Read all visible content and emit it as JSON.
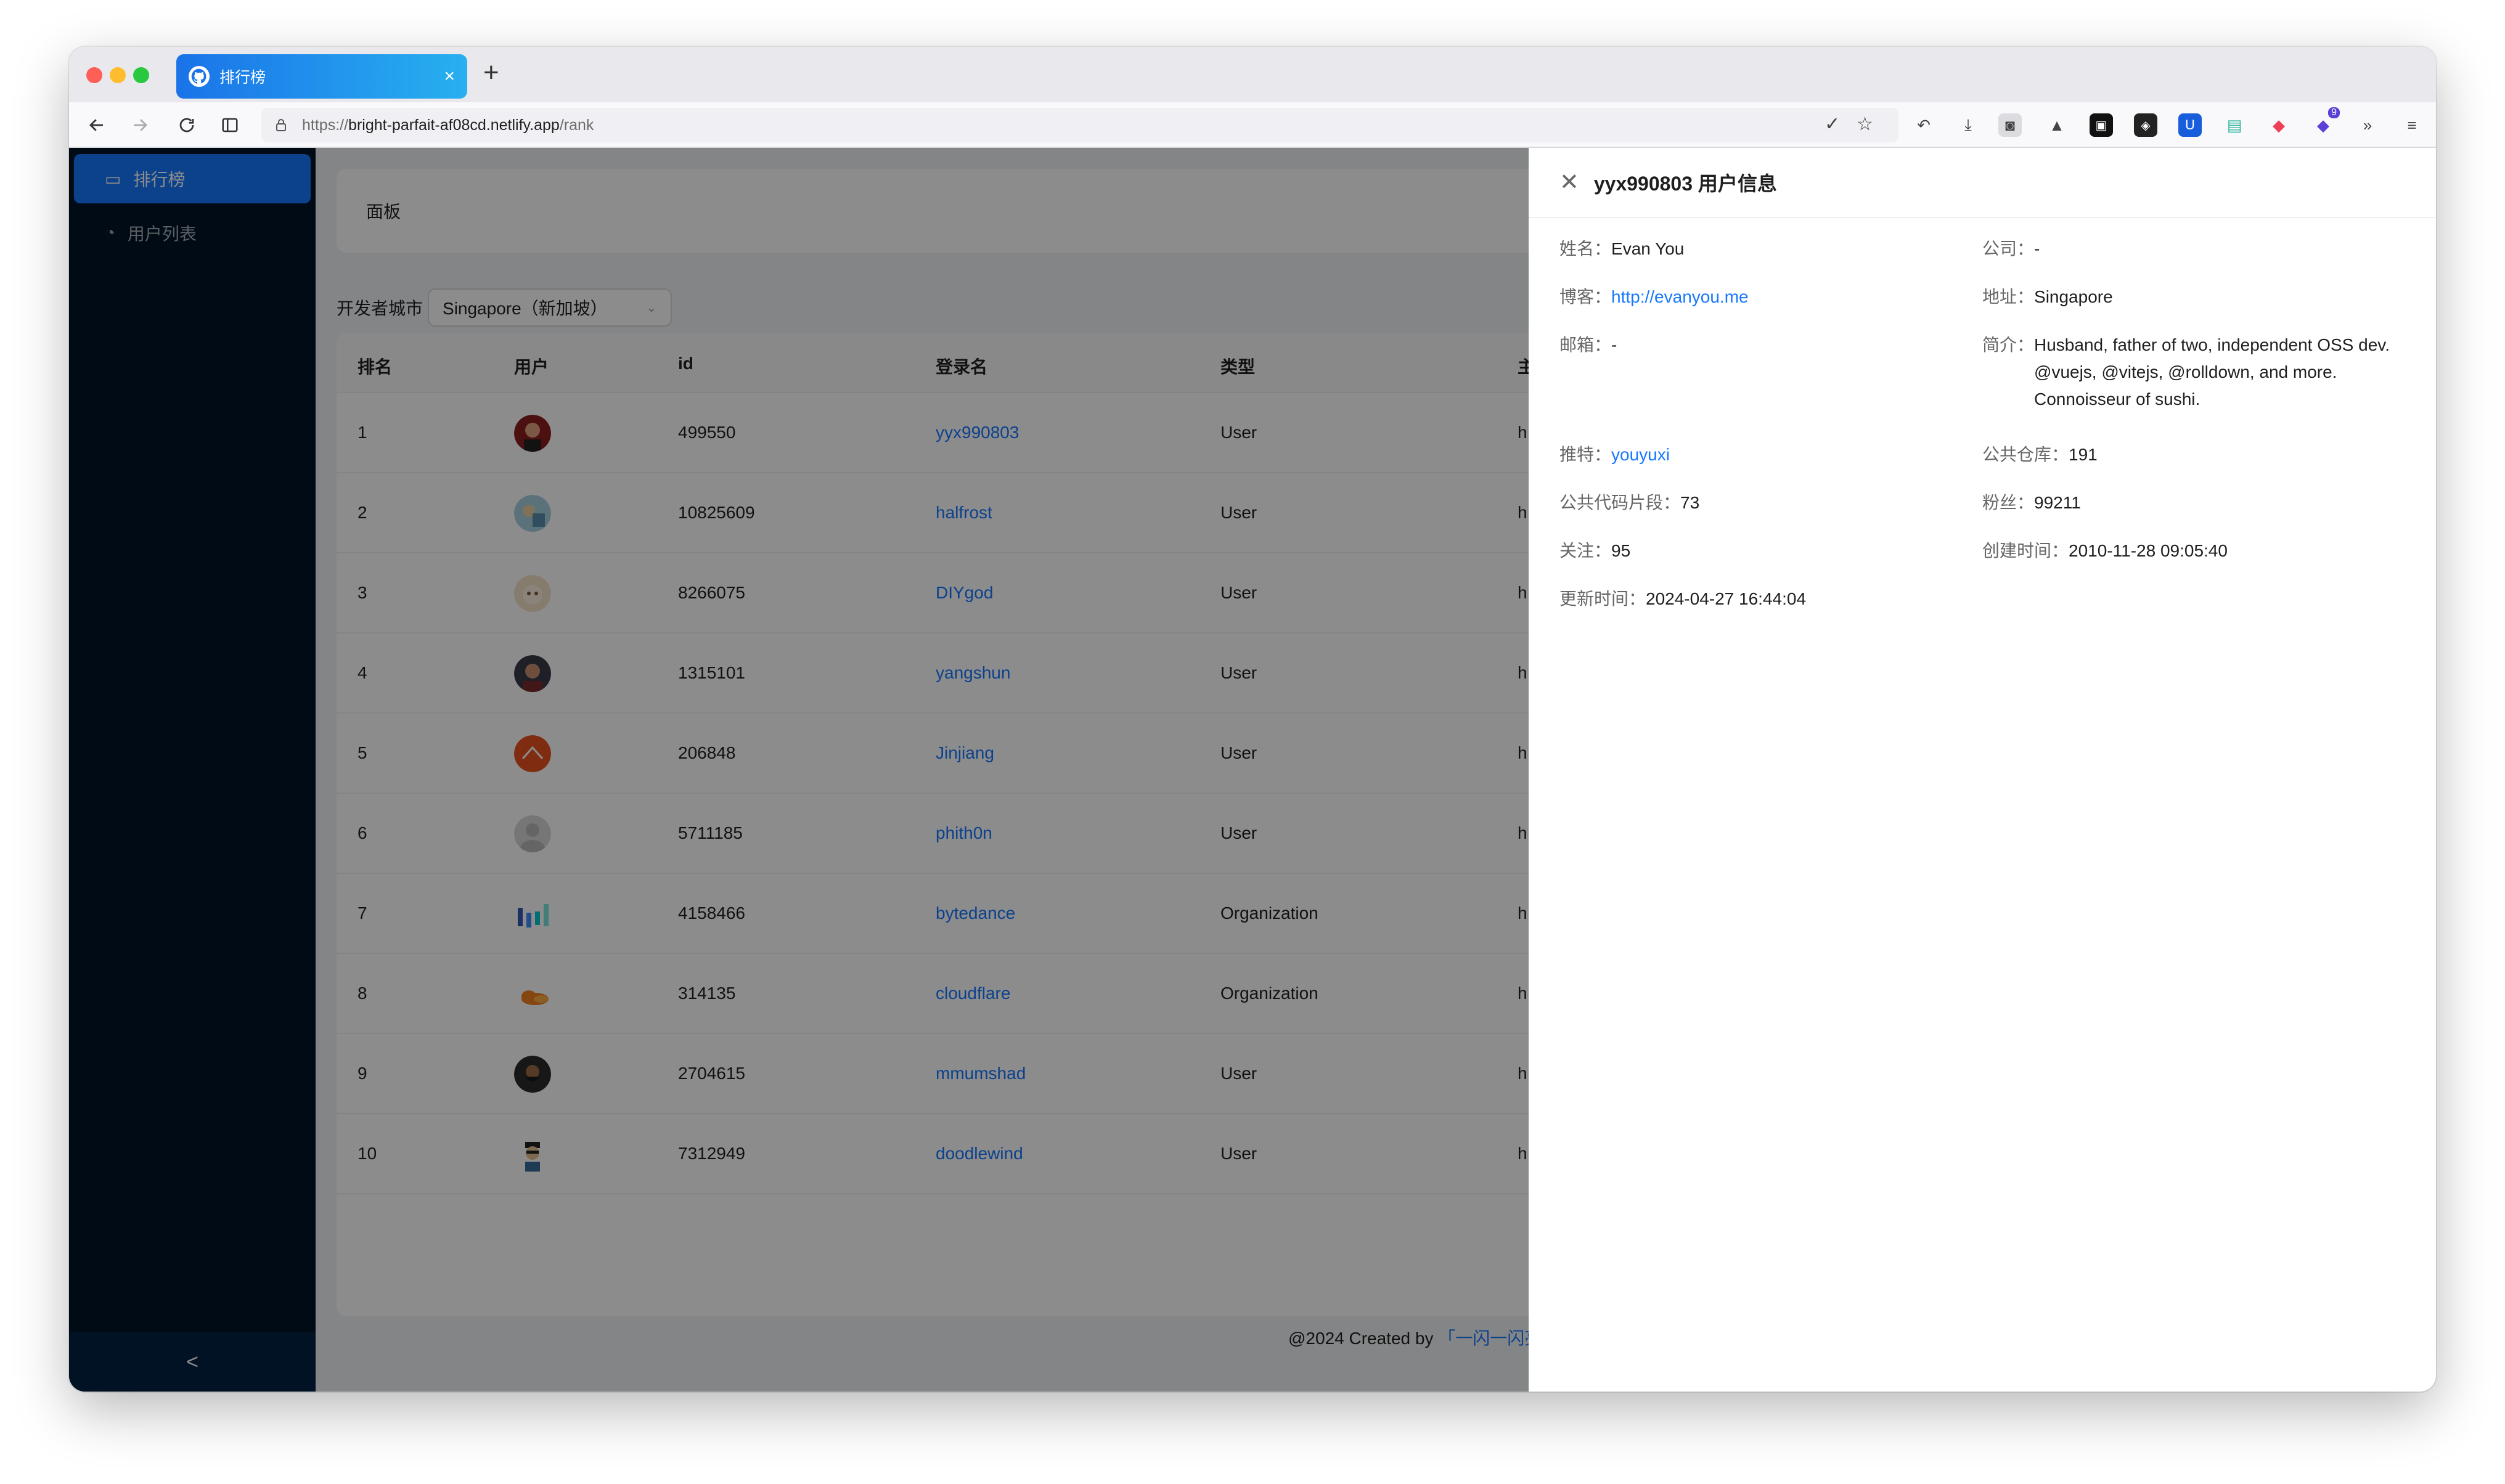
{
  "browser": {
    "tab_title": "排行榜",
    "url_prefix": "https://",
    "url_host": "bright-parfait-af08cd.netlify.app",
    "url_path": "/rank",
    "new_tab": "+",
    "tab_close": "×",
    "extension_badge": "9"
  },
  "sidebar": {
    "items": [
      {
        "label": "排行榜",
        "icon": "monitor-icon",
        "active": true
      },
      {
        "label": "用户列表",
        "icon": "pie-chart-icon",
        "active": false
      }
    ],
    "collapse": "<"
  },
  "panel": {
    "title": "面板"
  },
  "filter": {
    "label": "开发者城市",
    "value": "Singapore（新加坡）"
  },
  "table": {
    "columns": [
      "排名",
      "用户",
      "id",
      "登录名",
      "类型",
      "主"
    ],
    "rows": [
      {
        "rank": "1",
        "id": "499550",
        "login": "yyx990803",
        "type": "User",
        "trunc": "h"
      },
      {
        "rank": "2",
        "id": "10825609",
        "login": "halfrost",
        "type": "User",
        "trunc": "h"
      },
      {
        "rank": "3",
        "id": "8266075",
        "login": "DIYgod",
        "type": "User",
        "trunc": "h"
      },
      {
        "rank": "4",
        "id": "1315101",
        "login": "yangshun",
        "type": "User",
        "trunc": "h"
      },
      {
        "rank": "5",
        "id": "206848",
        "login": "Jinjiang",
        "type": "User",
        "trunc": "h"
      },
      {
        "rank": "6",
        "id": "5711185",
        "login": "phith0n",
        "type": "User",
        "trunc": "h"
      },
      {
        "rank": "7",
        "id": "4158466",
        "login": "bytedance",
        "type": "Organization",
        "trunc": "h"
      },
      {
        "rank": "8",
        "id": "314135",
        "login": "cloudflare",
        "type": "Organization",
        "trunc": "h"
      },
      {
        "rank": "9",
        "id": "2704615",
        "login": "mmumshad",
        "type": "User",
        "trunc": "h"
      },
      {
        "rank": "10",
        "id": "7312949",
        "login": "doodlewind",
        "type": "User",
        "trunc": "h"
      }
    ]
  },
  "footer": {
    "text": "@2024 Created by ",
    "author": "「一闪一闪亮晶晶」"
  },
  "drawer": {
    "title": "yyx990803 用户信息",
    "fields": {
      "name": {
        "label": "姓名：",
        "value": "Evan You"
      },
      "company": {
        "label": "公司：",
        "value": "-"
      },
      "blog": {
        "label": "博客：",
        "value": "http://evanyou.me"
      },
      "location": {
        "label": "地址：",
        "value": "Singapore"
      },
      "email": {
        "label": "邮箱：",
        "value": "-"
      },
      "bio": {
        "label": "简介：",
        "value": "Husband, father of two, independent OSS dev. @vuejs, @vitejs, @rolldown, and more. Connoisseur of sushi."
      },
      "twitter": {
        "label": "推特：",
        "value": "youyuxi"
      },
      "public_repos": {
        "label": "公共仓库：",
        "value": "191"
      },
      "public_gists": {
        "label": "公共代码片段：",
        "value": "73"
      },
      "followers": {
        "label": "粉丝：",
        "value": "99211"
      },
      "following": {
        "label": "关注：",
        "value": "95"
      },
      "created_at": {
        "label": "创建时间：",
        "value": "2010-11-28 09:05:40"
      },
      "updated_at": {
        "label": "更新时间：",
        "value": "2024-04-27 16:44:04"
      }
    }
  },
  "colors": {
    "primary": "#1677ff",
    "sidebar": "#001529",
    "tab_gradient_start": "#1a73e8",
    "tab_gradient_end": "#28b0f0"
  }
}
